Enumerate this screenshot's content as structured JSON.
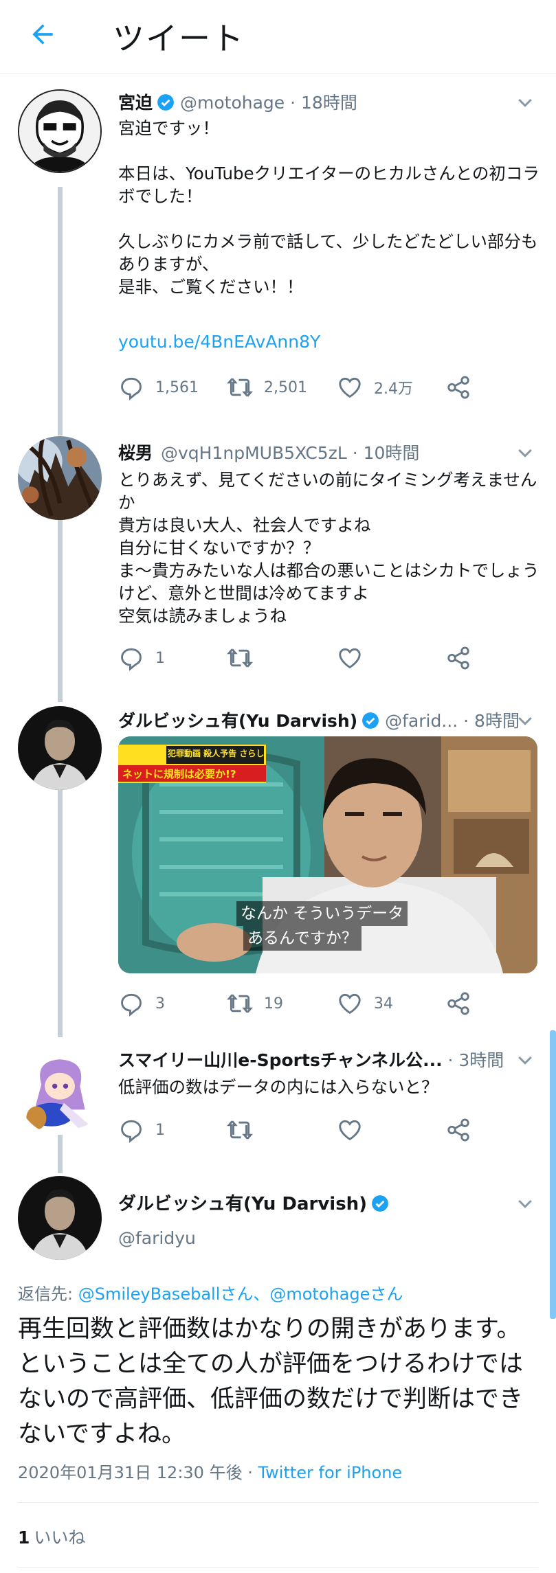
{
  "header": {
    "title": "ツイート"
  },
  "tweets": [
    {
      "name": "宮迫",
      "handle": "@motohage",
      "time": "18時間",
      "body": "宮迫ですッ！\n\n本日は、YouTubeクリエイターのヒカルさんとの初コラボでした！\n\n久しぶりにカメラ前で話して、少したどたどしい部分もありますが、\n是非、ご覧ください！！",
      "link": "youtu.be/4BnEAvAnn8Y",
      "replies": "1,561",
      "retweets": "2,501",
      "likes": "2.4万"
    },
    {
      "name": "桜男",
      "handle": "@vqH1npMUB5XC5zL",
      "time": "10時間",
      "body": "とりあえず、見てくださいの前にタイミング考えませんか\n貴方は良い大人、社会人ですよね\n自分に甘くないですか？？\nま〜貴方みたいな人は都合の悪いことはシカトでしょうけど、意外と世間は冷めてますよ\n空気は読みましょうね",
      "replies": "1",
      "retweets": "",
      "likes": ""
    },
    {
      "name": "ダルビッシュ有(Yu Darvish)",
      "handle": "@farid...",
      "time": "8時間",
      "media": {
        "caption_line1": "なんか そういうデータ",
        "caption_line2": "あるんですか？",
        "banner_top": "犯罪動画 殺人予告 さらし行為",
        "banner_bottom": "ネットに規制は必要か!?"
      },
      "replies": "3",
      "retweets": "19",
      "likes": "34"
    },
    {
      "name": "スマイリー山川e-Sportsチャンネル公...",
      "handle": "",
      "time": "3時間",
      "body": "低評価の数はデータの内には入らないと？",
      "replies": "1",
      "retweets": "",
      "likes": ""
    }
  ],
  "focus": {
    "name": "ダルビッシュ有(Yu Darvish)",
    "handle": "@faridyu",
    "reply_prefix": "返信先: ",
    "reply_targets": "@SmileyBaseballさん、@motohageさん",
    "body": "再生回数と評価数はかなりの開きがあります。ということは全ての人が評価をつけるわけではないので高評価、低評価の数だけで判断はできないですよね。",
    "timestamp": "2020年01月31日 12:30 午後 · ",
    "source": "Twitter for iPhone",
    "like_count": "1",
    "like_label": "いいね"
  },
  "colors": {
    "accent": "#1da1f2",
    "muted": "#657786",
    "thread": "#c4cfd6"
  }
}
